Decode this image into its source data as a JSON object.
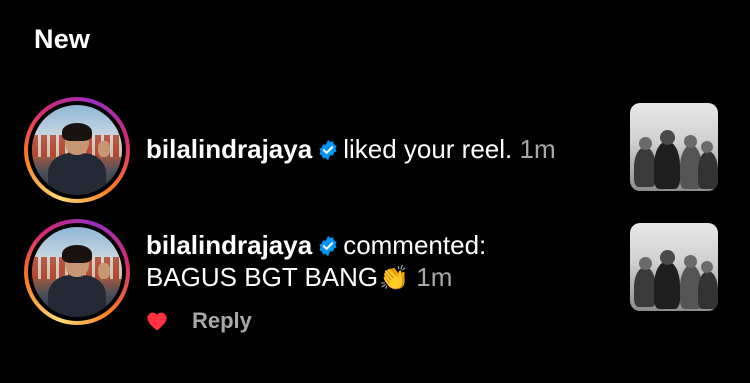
{
  "section": {
    "title": "New"
  },
  "notifications": [
    {
      "username": "bilalindrajaya",
      "action": "liked your reel.",
      "time": "1m",
      "icons": {
        "verified": "verified-badge-icon",
        "thumb": "reel-thumbnail"
      }
    },
    {
      "username": "bilalindrajaya",
      "action": "commented:",
      "comment": "BAGUS BGT BANG",
      "emoji": "👏",
      "time": "1m",
      "reply_label": "Reply",
      "icons": {
        "like": "heart-icon",
        "emoji": "clapping-hands-icon"
      }
    }
  ],
  "colors": {
    "verified": "#0095f6",
    "heart": "#ff3040",
    "muted": "#a8a8a8",
    "background": "#000000"
  }
}
